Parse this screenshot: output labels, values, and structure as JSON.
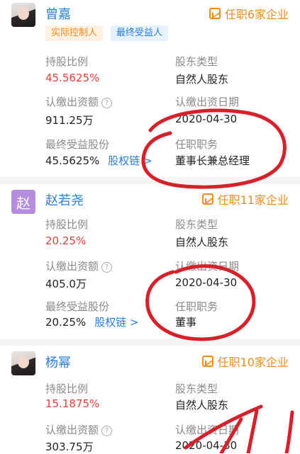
{
  "shareholders": [
    {
      "name": "曾嘉",
      "avatar_type": "photo",
      "jobs": "任职6家企业",
      "tags": [
        "实际控制人",
        "最终受益人"
      ],
      "share_ratio_label": "持股比例",
      "share_ratio": "45.5625%",
      "holder_type_label": "股东类型",
      "holder_type": "自然人股东",
      "capital_label": "认缴出资额",
      "capital": "911.25万",
      "capital_date_label": "认缴出资日期",
      "capital_date": "2020-04-30",
      "ultimate_label": "最终受益股份",
      "ultimate": "45.5625%",
      "equity_link": "股权链",
      "position_label": "任职职务",
      "position": "董事长兼总经理"
    },
    {
      "name": "赵若尧",
      "avatar_char": "赵",
      "jobs": "任职11家企业",
      "share_ratio_label": "持股比例",
      "share_ratio": "20.25%",
      "holder_type_label": "股东类型",
      "holder_type": "自然人股东",
      "capital_label": "认缴出资额",
      "capital": "405.0万",
      "capital_date_label": "认缴出资日期",
      "capital_date": "2020-04-30",
      "ultimate_label": "最终受益股份",
      "ultimate": "20.25%",
      "equity_link": "股权链",
      "position_label": "任职职务",
      "position": "董事"
    },
    {
      "name": "杨幂",
      "avatar_type": "photo",
      "jobs": "任职10家企业",
      "share_ratio_label": "持股比例",
      "share_ratio": "15.1875%",
      "holder_type_label": "股东类型",
      "holder_type": "自然人股东",
      "capital_label": "认缴出资额",
      "capital": "303.75万",
      "capital_date_label": "认缴出资日期",
      "capital_date": "2020-04-30"
    }
  ],
  "colors": {
    "name_blue": "#2a7fd8",
    "ratio_red": "#e0403a",
    "jobs_orange": "#f08a1a",
    "marker_red": "#d8202a"
  },
  "icons": {
    "jobs": "chart-trend-icon",
    "help": "question-circle-icon",
    "link": "chevron-right-icon"
  }
}
